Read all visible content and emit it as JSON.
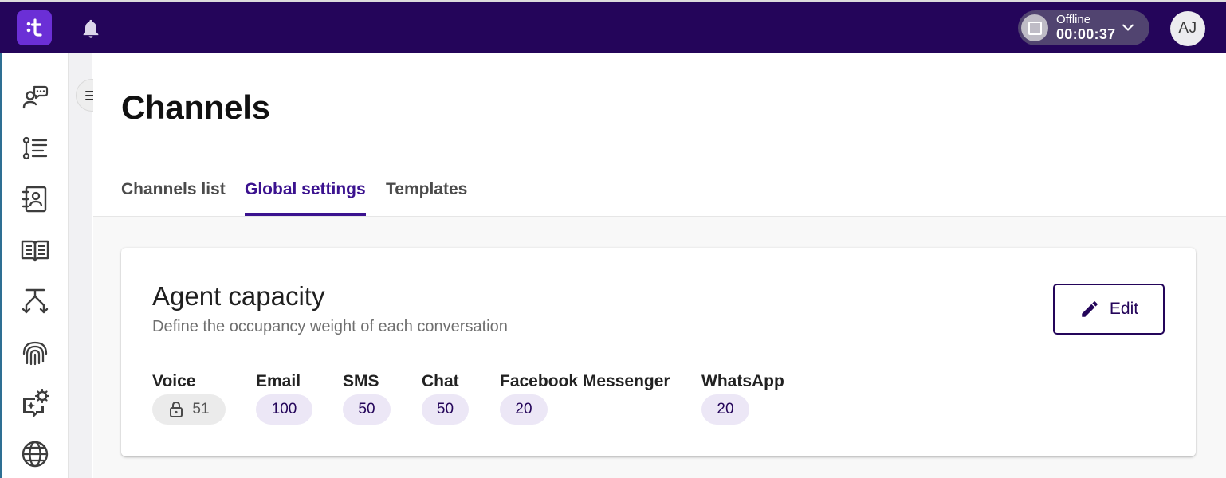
{
  "header": {
    "logo_glyph": "t",
    "status": {
      "label": "Offline",
      "timer": "00:00:37"
    },
    "avatar_initials": "AJ"
  },
  "page": {
    "title": "Channels",
    "tabs": [
      {
        "label": "Channels list",
        "active": false
      },
      {
        "label": "Global settings",
        "active": true
      },
      {
        "label": "Templates",
        "active": false
      }
    ]
  },
  "agent_capacity": {
    "title": "Agent capacity",
    "subtitle": "Define the occupancy weight of each conversation",
    "edit_label": "Edit",
    "channels": [
      {
        "name": "Voice",
        "value": "51",
        "locked": true
      },
      {
        "name": "Email",
        "value": "100",
        "locked": false
      },
      {
        "name": "SMS",
        "value": "50",
        "locked": false
      },
      {
        "name": "Chat",
        "value": "50",
        "locked": false
      },
      {
        "name": "Facebook Messenger",
        "value": "20",
        "locked": false
      },
      {
        "name": "WhatsApp",
        "value": "20",
        "locked": false
      }
    ]
  },
  "colors": {
    "topbar": "#24055a",
    "accent": "#3b128f",
    "logo": "#6b2fd6",
    "chip": "#ece7f6"
  },
  "icons": {
    "rail": [
      "agent-chat-icon",
      "list-icon",
      "contacts-book-icon",
      "knowledge-book-icon",
      "routing-icon",
      "fingerprint-icon",
      "ai-settings-icon",
      "globe-icon"
    ],
    "header": [
      "bell-icon",
      "chevron-down-icon"
    ],
    "card": [
      "pencil-icon",
      "lock-icon"
    ]
  }
}
